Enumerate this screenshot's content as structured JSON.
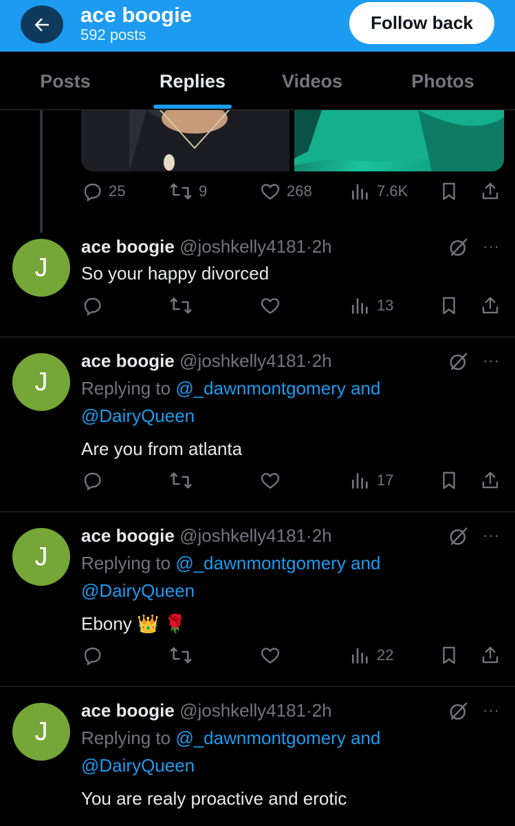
{
  "header": {
    "title": "ace boogie",
    "posts_count": "592 posts",
    "follow_label": "Follow back",
    "bg_color": "#1d9bf0"
  },
  "tabs": [
    {
      "label": "Posts",
      "active": false
    },
    {
      "label": "Replies",
      "active": true
    },
    {
      "label": "Videos",
      "active": false
    },
    {
      "label": "Photos",
      "active": false
    }
  ],
  "top_post_actions": {
    "replies": "25",
    "reposts": "9",
    "likes": "268",
    "views": "7.6K"
  },
  "posts": [
    {
      "avatar_letter": "J",
      "name": "ace boogie",
      "handle": "@joshkelly4181",
      "sep": "·",
      "time": "2h",
      "replying_to": null,
      "text": "So your happy divorced",
      "views": "13"
    },
    {
      "avatar_letter": "J",
      "name": "ace boogie",
      "handle": "@joshkelly4181",
      "sep": "·",
      "time": "2h",
      "replying_prefix": "Replying to",
      "replying_user1": "@_dawnmontgomery",
      "replying_and": "and",
      "replying_user2": "@DairyQueen",
      "text": "Are you from atlanta",
      "views": "17"
    },
    {
      "avatar_letter": "J",
      "name": "ace boogie",
      "handle": "@joshkelly4181",
      "sep": "·",
      "time": "2h",
      "replying_prefix": "Replying to",
      "replying_user1": "@_dawnmontgomery",
      "replying_and": "and",
      "replying_user2": "@DairyQueen",
      "text": "Ebony 👑  🌹",
      "views": "22"
    },
    {
      "avatar_letter": "J",
      "name": "ace boogie",
      "handle": "@joshkelly4181",
      "sep": "·",
      "time": "2h",
      "replying_prefix": "Replying to",
      "replying_user1": "@_dawnmontgomery",
      "replying_and": "and",
      "replying_user2": "@DairyQueen",
      "text": "You are realy proactive and erotic"
    }
  ],
  "more_glyph": "···"
}
